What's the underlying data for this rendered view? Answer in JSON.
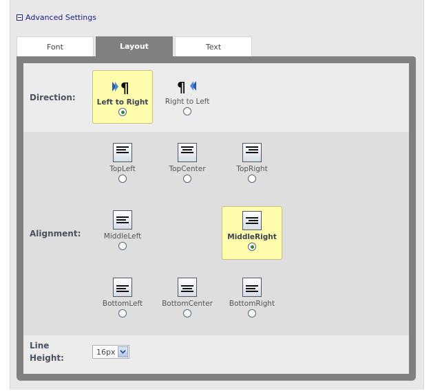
{
  "advanced": {
    "label": "Advanced Settings"
  },
  "tabs": [
    {
      "label": "Font",
      "active": false
    },
    {
      "label": "Layout",
      "active": true
    },
    {
      "label": "Text",
      "active": false
    }
  ],
  "direction": {
    "label": "Direction:",
    "options": [
      {
        "label": "Left to Right",
        "icon": "ltr-paragraph-icon",
        "selected": true
      },
      {
        "label": "Right to Left",
        "icon": "rtl-paragraph-icon",
        "selected": false
      }
    ]
  },
  "alignment": {
    "label": "Alignment:",
    "options": [
      {
        "label": "TopLeft",
        "selected": false
      },
      {
        "label": "TopCenter",
        "selected": false
      },
      {
        "label": "TopRight",
        "selected": false
      },
      {
        "label": "MiddleLeft",
        "selected": false
      },
      {
        "label": "MiddleRight",
        "selected": true
      },
      {
        "label": "BottomLeft",
        "selected": false
      },
      {
        "label": "BottomCenter",
        "selected": false
      },
      {
        "label": "BottomRight",
        "selected": false
      }
    ]
  },
  "line_height": {
    "label_line1": "Line",
    "label_line2": "Height:",
    "value": "16px"
  },
  "colors": {
    "selected_bg": "#fffcae",
    "panel_frame": "#808080",
    "label_text": "#4a5260",
    "link_blue": "#1a1a8c"
  }
}
